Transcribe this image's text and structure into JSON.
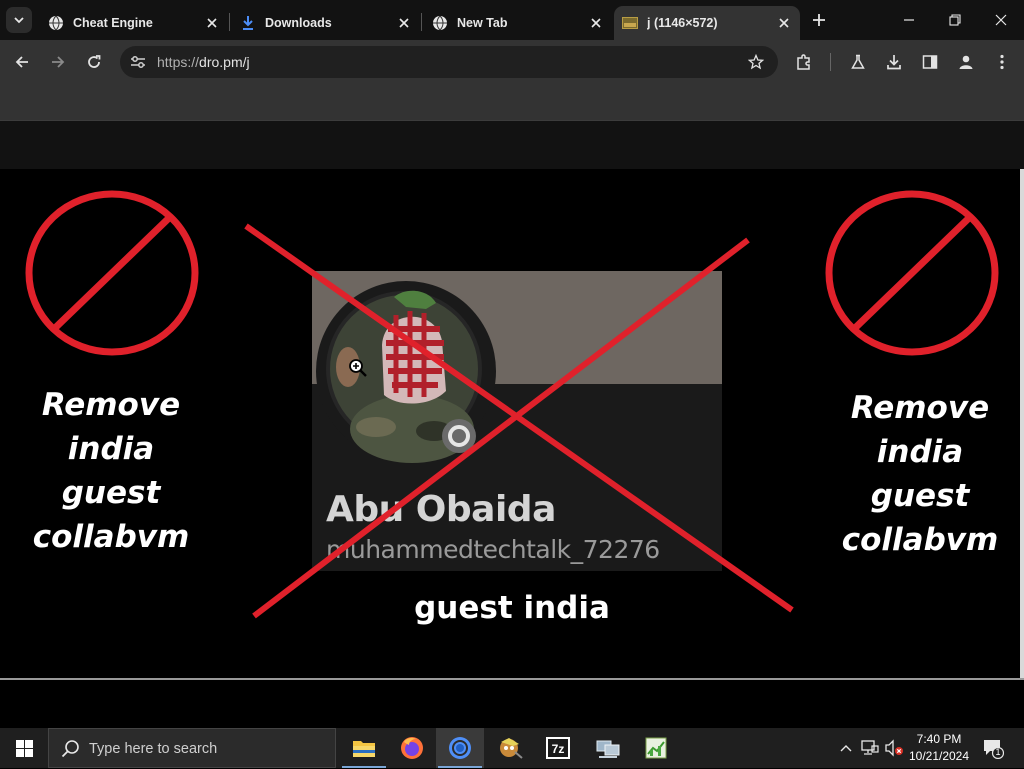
{
  "browser": {
    "tabs": [
      {
        "title": "Cheat Engine",
        "favicon": "globe-icon",
        "active": false
      },
      {
        "title": "Downloads",
        "favicon": "download-icon",
        "active": false
      },
      {
        "title": "New Tab",
        "favicon": "globe-icon",
        "active": false
      },
      {
        "title": "j (1146×572)",
        "favicon": "image-icon",
        "active": true
      }
    ],
    "url_scheme": "https://",
    "url_host": "dro.pm/j",
    "accent": "#1a73e8"
  },
  "page": {
    "left_text": [
      "Remove",
      "india",
      "guest",
      "collabvm"
    ],
    "right_text": [
      "Remove",
      "india",
      "guest",
      "collabvm"
    ],
    "card_name": "Abu Obaida",
    "card_handle": "muhammedtechtalk_72276",
    "caption": "guest india",
    "mark_color": "#e0212b"
  },
  "taskbar": {
    "search_placeholder": "Type here to search",
    "apps": [
      "file-explorer",
      "firefox",
      "chrome",
      "app-mascot",
      "7zip",
      "network-app",
      "task-manager-app"
    ],
    "time": "7:40 PM",
    "date": "10/21/2024",
    "notification_count": "1"
  }
}
